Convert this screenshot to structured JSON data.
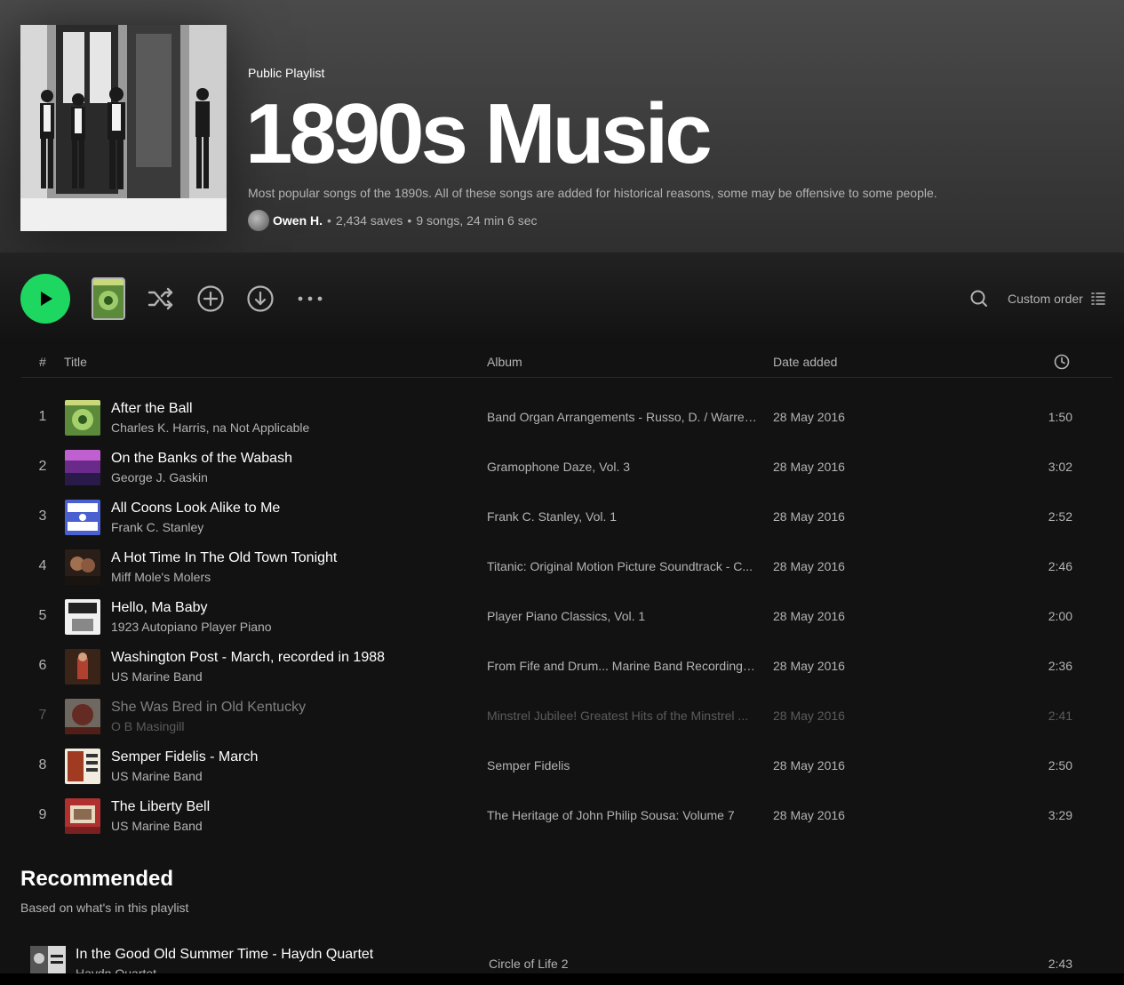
{
  "playlist": {
    "type": "Public Playlist",
    "title": "1890s Music",
    "description": "Most popular songs of the 1890s. All of these songs are added for historical reasons, some may be offensive to some people.",
    "owner": "Owen H.",
    "saves": "2,434 saves",
    "summary": "9 songs, 24 min 6 sec"
  },
  "actions": {
    "sort_label": "Custom order"
  },
  "columns": {
    "number": "#",
    "title": "Title",
    "album": "Album",
    "date_added": "Date added"
  },
  "tracks": [
    {
      "num": "1",
      "title": "After the Ball",
      "artist": "Charles K. Harris, na Not Applicable",
      "album": "Band Organ Arrangements - Russo, D. / Warren...",
      "date": "28 May 2016",
      "duration": "1:50",
      "art_color": "#3b7a3b"
    },
    {
      "num": "2",
      "title": "On the Banks of the Wabash",
      "artist": "George J. Gaskin",
      "album": "Gramophone Daze, Vol. 3",
      "date": "28 May 2016",
      "duration": "3:02",
      "art_color": "#7a3b8f"
    },
    {
      "num": "3",
      "title": "All Coons Look Alike to Me",
      "artist": "Frank C. Stanley",
      "album": "Frank C. Stanley, Vol. 1",
      "date": "28 May 2016",
      "duration": "2:52",
      "art_color": "#4a5fd0"
    },
    {
      "num": "4",
      "title": "A Hot Time In The Old Town Tonight",
      "artist": "Miff Mole's Molers",
      "album": "Titanic: Original Motion Picture Soundtrack - C...",
      "date": "28 May 2016",
      "duration": "2:46",
      "art_color": "#3a2a20"
    },
    {
      "num": "5",
      "title": "Hello, Ma Baby",
      "artist": "1923 Autopiano Player Piano",
      "album": "Player Piano Classics, Vol. 1",
      "date": "28 May 2016",
      "duration": "2:00",
      "art_color": "#e8e8e8"
    },
    {
      "num": "6",
      "title": "Washington Post - March, recorded in 1988",
      "artist": "US Marine Band",
      "album": "From Fife and Drum... Marine Band Recordings ...",
      "date": "28 May 2016",
      "duration": "2:36",
      "art_color": "#3a2418"
    },
    {
      "num": "7",
      "title": "She Was Bred in Old Kentucky",
      "artist": "O B Masingill",
      "album": "Minstrel Jubilee! Greatest Hits of the Minstrel ...",
      "date": "28 May 2016",
      "duration": "2:41",
      "art_color": "#c94a3a",
      "unavailable": true
    },
    {
      "num": "8",
      "title": "Semper Fidelis - March",
      "artist": "US Marine Band",
      "album": "Semper Fidelis",
      "date": "28 May 2016",
      "duration": "2:50",
      "art_color": "#e0d8c8"
    },
    {
      "num": "9",
      "title": "The Liberty Bell",
      "artist": "US Marine Band",
      "album": "The Heritage of John Philip Sousa: Volume 7",
      "date": "28 May 2016",
      "duration": "3:29",
      "art_color": "#b03030"
    }
  ],
  "recommended": {
    "heading": "Recommended",
    "subheading": "Based on what's in this playlist",
    "items": [
      {
        "title": "In the Good Old Summer Time - Haydn Quartet",
        "artist": "Haydn Quartet",
        "album": "Circle of Life 2",
        "duration": "2:43"
      }
    ]
  },
  "colors": {
    "accent": "#1ed760",
    "background": "#121212",
    "muted_text": "#b3b3b3"
  }
}
